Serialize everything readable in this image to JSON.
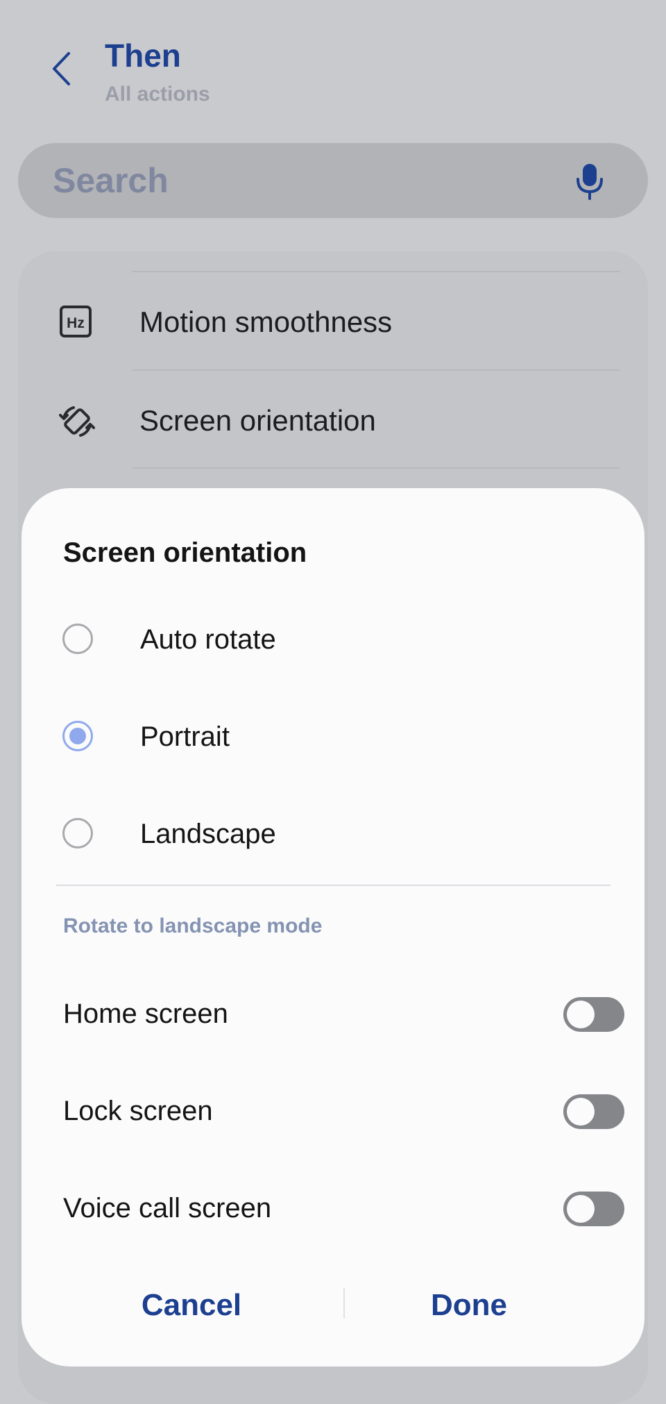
{
  "header": {
    "title": "Then",
    "subtitle": "All actions"
  },
  "search": {
    "placeholder": "Search"
  },
  "list": {
    "items": [
      {
        "label": "Motion smoothness",
        "icon": "hz-icon"
      },
      {
        "label": "Screen orientation",
        "icon": "rotate-icon"
      }
    ]
  },
  "dialog": {
    "title": "Screen orientation",
    "options": [
      {
        "label": "Auto rotate",
        "checked": false
      },
      {
        "label": "Portrait",
        "checked": true
      },
      {
        "label": "Landscape",
        "checked": false
      }
    ],
    "section_header": "Rotate to landscape mode",
    "toggles": [
      {
        "label": "Home screen",
        "on": false
      },
      {
        "label": "Lock screen",
        "on": false
      },
      {
        "label": "Voice call screen",
        "on": false
      }
    ],
    "cancel_label": "Cancel",
    "done_label": "Done"
  },
  "colors": {
    "accent": "#1c3f8f",
    "radio_checked": "#8fa9ec",
    "toggle_off": "#85868a",
    "scrim": "#c9cace",
    "dialog_bg": "#fbfbfc"
  }
}
